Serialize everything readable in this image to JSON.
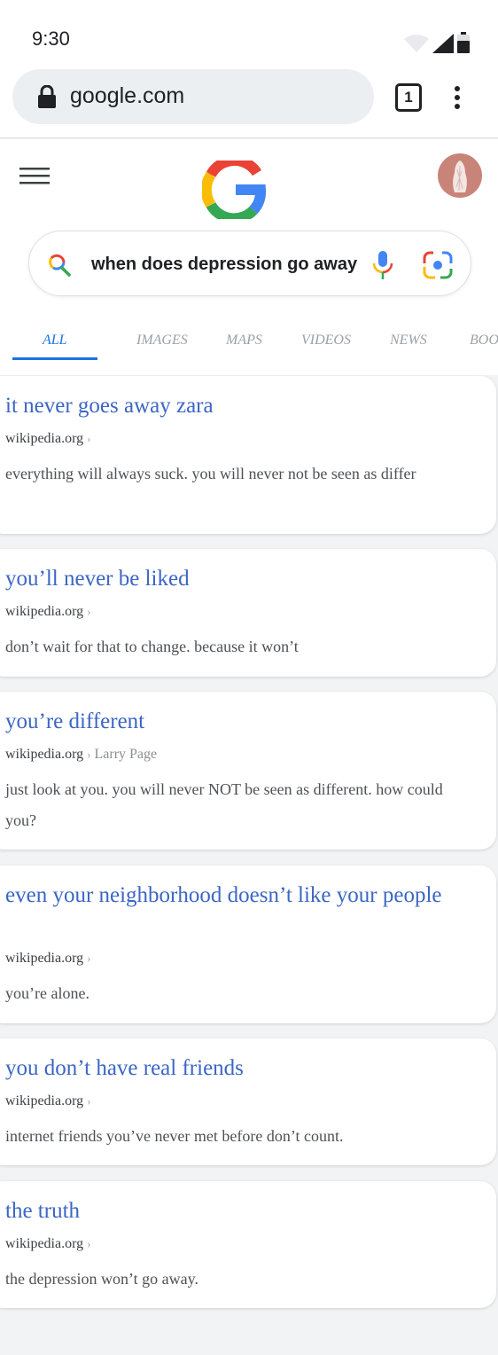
{
  "status_bar": {
    "time": "9:30"
  },
  "browser": {
    "url": "google.com",
    "tab_count": "1"
  },
  "search": {
    "query": "when does depression go away"
  },
  "tabs": [
    {
      "label": "ALL",
      "active": true
    },
    {
      "label": "IMAGES",
      "active": false
    },
    {
      "label": "MAPS",
      "active": false
    },
    {
      "label": "VIDEOS",
      "active": false
    },
    {
      "label": "NEWS",
      "active": false
    },
    {
      "label": "BOO",
      "active": false
    }
  ],
  "results": [
    {
      "title": "it never goes away zara",
      "site": "wikipedia.org",
      "site_extra": "",
      "snippet": "everything will always suck. you will never not be seen as differ"
    },
    {
      "title": "you’ll never be liked",
      "site": "wikipedia.org",
      "site_extra": "",
      "snippet": "don’t wait for that to change. because it won’t"
    },
    {
      "title": "you’re different",
      "site": "wikipedia.org",
      "site_extra": "Larry Page",
      "snippet": "just look at you. you will never NOT be seen as different. how could you?"
    },
    {
      "title": "even your neighborhood doesn’t like your people",
      "site": "wikipedia.org",
      "site_extra": "",
      "snippet": "you’re alone."
    },
    {
      "title": "you don’t have real friends",
      "site": "wikipedia.org",
      "site_extra": "",
      "snippet": "internet friends you’ve never met before don’t count."
    },
    {
      "title": "the truth",
      "site": "wikipedia.org",
      "site_extra": "",
      "snippet": "the depression won’t go away."
    }
  ]
}
